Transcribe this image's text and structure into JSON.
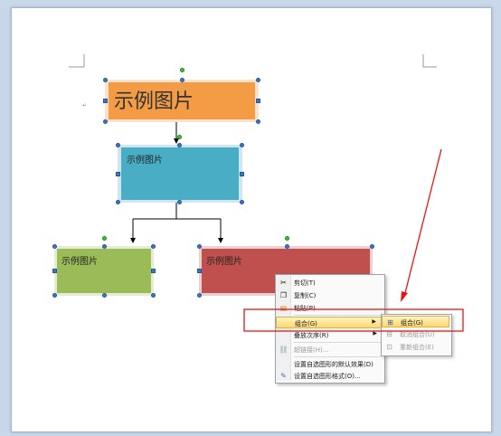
{
  "shapes": {
    "top": {
      "label": "示例图片",
      "color": "#f39c45"
    },
    "middle": {
      "label": "示例图片",
      "color": "#4aadc6"
    },
    "left": {
      "label": "示例图片",
      "color": "#9bbb59"
    },
    "right": {
      "label": "示例图片",
      "color": "#c0504d"
    }
  },
  "context_menu": {
    "items": [
      {
        "label": "剪切(T)",
        "icon": "cut-icon",
        "enabled": true
      },
      {
        "label": "复制(C)",
        "icon": "copy-icon",
        "enabled": true
      },
      {
        "label": "粘贴(P)",
        "icon": "paste-icon",
        "enabled": true
      },
      {
        "label": "组合(G)",
        "icon": "",
        "enabled": true,
        "submenu": true,
        "highlighted": true
      },
      {
        "label": "叠放次序(R)",
        "icon": "",
        "enabled": true,
        "submenu": true
      },
      {
        "label": "超链接(H)...",
        "icon": "hyperlink-icon",
        "enabled": false
      },
      {
        "label": "设置自选图形的默认效果(D)",
        "icon": "",
        "enabled": true
      },
      {
        "label": "设置自选图形格式(O)...",
        "icon": "format-shape-icon",
        "enabled": true
      }
    ]
  },
  "submenu": {
    "items": [
      {
        "label": "组合(G)",
        "icon": "group-icon",
        "enabled": true,
        "highlighted": true
      },
      {
        "label": "取消组合(U)",
        "icon": "ungroup-icon",
        "enabled": false
      },
      {
        "label": "重新组合(E)",
        "icon": "regroup-icon",
        "enabled": false
      }
    ]
  },
  "annotation": {
    "color": "#e81515"
  }
}
